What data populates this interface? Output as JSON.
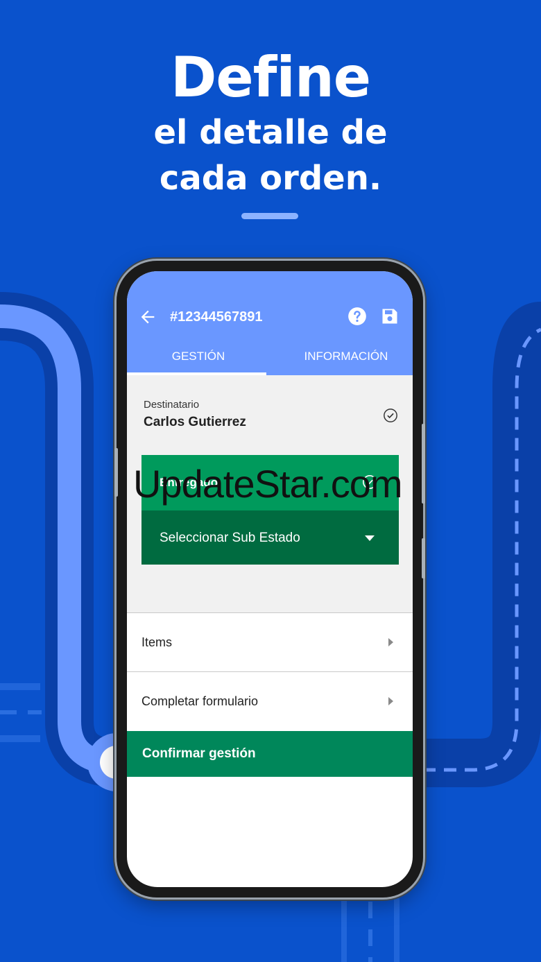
{
  "headline": {
    "line1": "Define",
    "line2": "el detalle de",
    "line3": "cada orden."
  },
  "colors": {
    "background": "#0a52cc",
    "appbar": "#6a97ff",
    "status_green": "#009a5c",
    "substate_green": "#006b40",
    "confirm_green": "#00875a"
  },
  "appbar": {
    "title": "#12344567891",
    "back_icon": "arrow-left-icon",
    "help_icon": "help-circle-icon",
    "save_icon": "floppy-disk-icon"
  },
  "tabs": [
    {
      "label": "GESTIÓN",
      "active": true
    },
    {
      "label": "INFORMACIÓN",
      "active": false
    }
  ],
  "recipient": {
    "label": "Destinatario",
    "name": "Carlos Gutierrez"
  },
  "status": {
    "label": "Entregado",
    "substate_placeholder": "Seleccionar Sub Estado"
  },
  "rows": [
    {
      "label": "Items"
    },
    {
      "label": "Completar formulario"
    }
  ],
  "confirm": {
    "label": "Confirmar gestión"
  },
  "watermark": "UpdateStar.com"
}
